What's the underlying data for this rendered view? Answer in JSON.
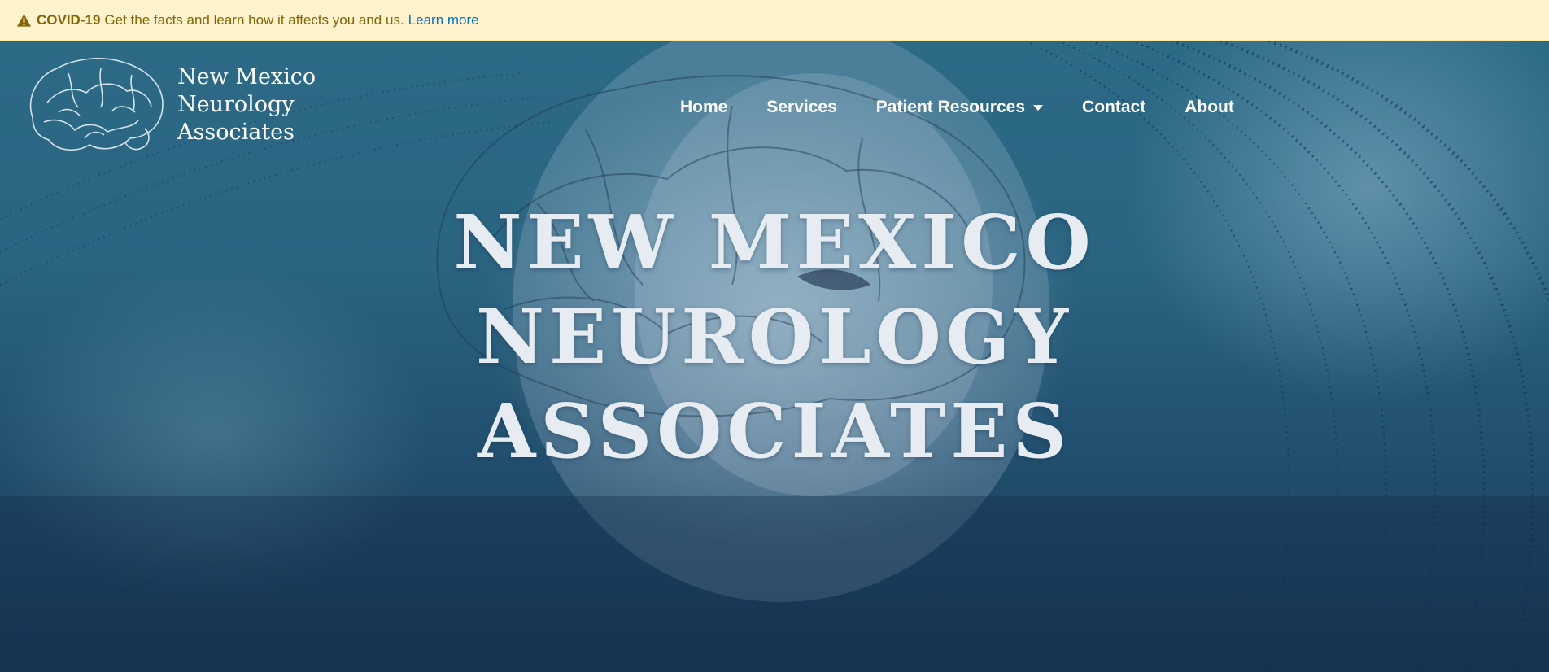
{
  "alert": {
    "icon": "warning-triangle-icon",
    "label": "COVID-19",
    "message": "Get the facts and learn how it affects you and us.",
    "link": "Learn more",
    "colors": {
      "background": "#fff3cd",
      "text": "#856404",
      "link": "#0a6fc2"
    }
  },
  "brand": {
    "logo_icon": "brain-icon",
    "line1": "New Mexico",
    "line2": "Neurology",
    "line3": "Associates"
  },
  "nav": {
    "home": "Home",
    "services": "Services",
    "patient_resources": "Patient Resources",
    "contact": "Contact",
    "about": "About"
  },
  "hero": {
    "line1": "NEW MEXICO",
    "line2": "NEUROLOGY",
    "line3": "ASSOCIATES"
  }
}
